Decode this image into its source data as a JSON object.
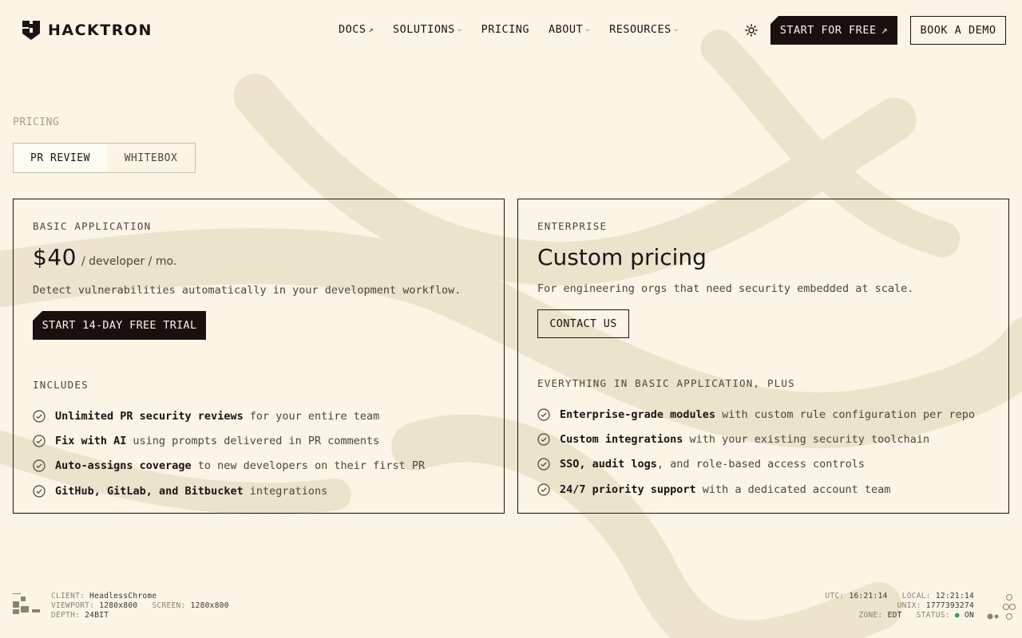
{
  "brand": {
    "name": "HACKTRON",
    "logo_icon": "shield-h-icon"
  },
  "nav": {
    "items": [
      {
        "label": "DOCS",
        "suffix": "↗"
      },
      {
        "label": "SOLUTIONS",
        "suffix": "⌵"
      },
      {
        "label": "PRICING",
        "suffix": ""
      },
      {
        "label": "ABOUT",
        "suffix": "⌵"
      },
      {
        "label": "RESOURCES",
        "suffix": "⌵"
      }
    ],
    "theme_icon": "sun-icon",
    "start_label": "START FOR FREE",
    "start_suffix": "↗",
    "demo_label": "BOOK A DEMO"
  },
  "pricing": {
    "section_label": "PRICING",
    "tabs": [
      {
        "label": "PR REVIEW",
        "active": true
      },
      {
        "label": "WHITEBOX",
        "active": false
      }
    ],
    "basic": {
      "label": "BASIC APPLICATION",
      "price": "$40",
      "unit": "/ developer / mo.",
      "description": "Detect vulnerabilities automatically in your development workflow.",
      "cta": "START 14-DAY FREE TRIAL",
      "includes_label": "INCLUDES",
      "features": [
        {
          "strong": "Unlimited PR security reviews",
          "rest": "for your entire team"
        },
        {
          "strong": "Fix with AI",
          "rest": "using prompts delivered in PR comments"
        },
        {
          "strong": "Auto-assigns coverage",
          "rest": "to new developers on their first PR"
        },
        {
          "strong": "GitHub, GitLab, and Bitbucket",
          "rest": "integrations"
        }
      ]
    },
    "enterprise": {
      "label": "ENTERPRISE",
      "price": "Custom pricing",
      "description": "For engineering orgs that need security embedded at scale.",
      "cta": "CONTACT US",
      "includes_label": "EVERYTHING IN BASIC APPLICATION, PLUS",
      "features": [
        {
          "strong": "Enterprise-grade modules",
          "rest": "with custom rule configuration per repo"
        },
        {
          "strong": "Custom integrations",
          "rest": "with your existing security toolchain"
        },
        {
          "strong": "SSO, audit logs",
          "rest": ", and role-based access controls"
        },
        {
          "strong": "24/7 priority support",
          "rest": "with a dedicated account team"
        }
      ]
    }
  },
  "status": {
    "client_label": "CLIENT:",
    "client": "HeadlessChrome",
    "viewport_label": "VIEWPORT:",
    "viewport": "1280x800",
    "screen_label": "SCREEN:",
    "screen": "1280x800",
    "depth_label": "DEPTH:",
    "depth": "24BIT",
    "utc_label": "UTC:",
    "utc": "16:21:14",
    "local_label": "LOCAL:",
    "local": "12:21:14",
    "unix_label": "UNIX:",
    "unix": "1777393274",
    "zone_label": "ZONE:",
    "zone": "EDT",
    "status_label": "STATUS:",
    "status_dot": "●",
    "status_value": "ON"
  },
  "colors": {
    "background": "#fcf4e4",
    "ink": "#1a1414",
    "muted": "#4b453c",
    "status_on": "#2aa05a"
  }
}
